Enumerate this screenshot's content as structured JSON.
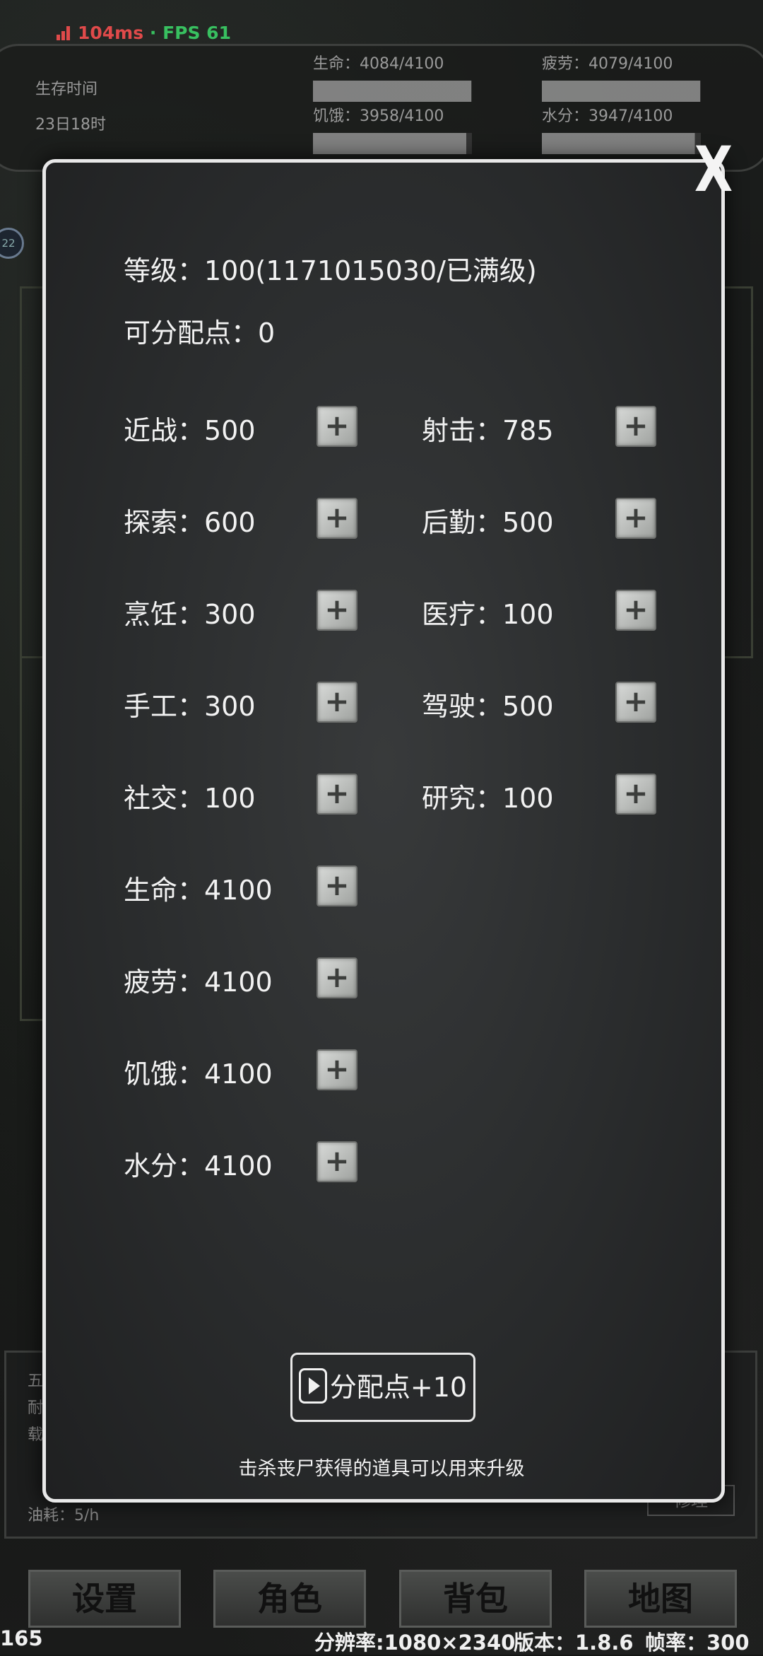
{
  "status": {
    "latency": "104ms",
    "sep": "·",
    "fps": "FPS 61"
  },
  "survival": {
    "label": "生存时间",
    "value": "23日18时"
  },
  "stats": [
    {
      "label": "生命：4084/4100",
      "fill": 0.996
    },
    {
      "label": "疲劳：4079/4100",
      "fill": 0.995
    },
    {
      "label": "饥饿：3958/4100",
      "fill": 0.965
    },
    {
      "label": "水分：3947/4100",
      "fill": 0.963
    }
  ],
  "badge": "22",
  "background_info": {
    "lines": [
      "五",
      "耐",
      "载",
      "油耗：5/h"
    ],
    "repair": "修理"
  },
  "nav": [
    "设置",
    "角色",
    "背包",
    "地图"
  ],
  "footer": {
    "left": "165",
    "resolution": "分辨率:1080×2340",
    "version": "版本：1.8.6",
    "framerate": "帧率：300"
  },
  "modal": {
    "close": "X",
    "level": "等级：100(1171015030/已满级)",
    "points": "可分配点：0",
    "attributes": [
      {
        "label": "近战：500"
      },
      {
        "label": "射击：785"
      },
      {
        "label": "探索：600"
      },
      {
        "label": "后勤：500"
      },
      {
        "label": "烹饪：300"
      },
      {
        "label": "医疗：100"
      },
      {
        "label": "手工：300"
      },
      {
        "label": "驾驶：500"
      },
      {
        "label": "社交：100"
      },
      {
        "label": "研究：100"
      },
      {
        "label": "生命：4100"
      },
      {
        "label": "疲劳：4100"
      },
      {
        "label": "饥饿：4100"
      },
      {
        "label": "水分：4100"
      }
    ],
    "plus_symbol": "+",
    "ad_button": "分配点+10",
    "hint": "击杀丧尸获得的道具可以用来升级"
  }
}
